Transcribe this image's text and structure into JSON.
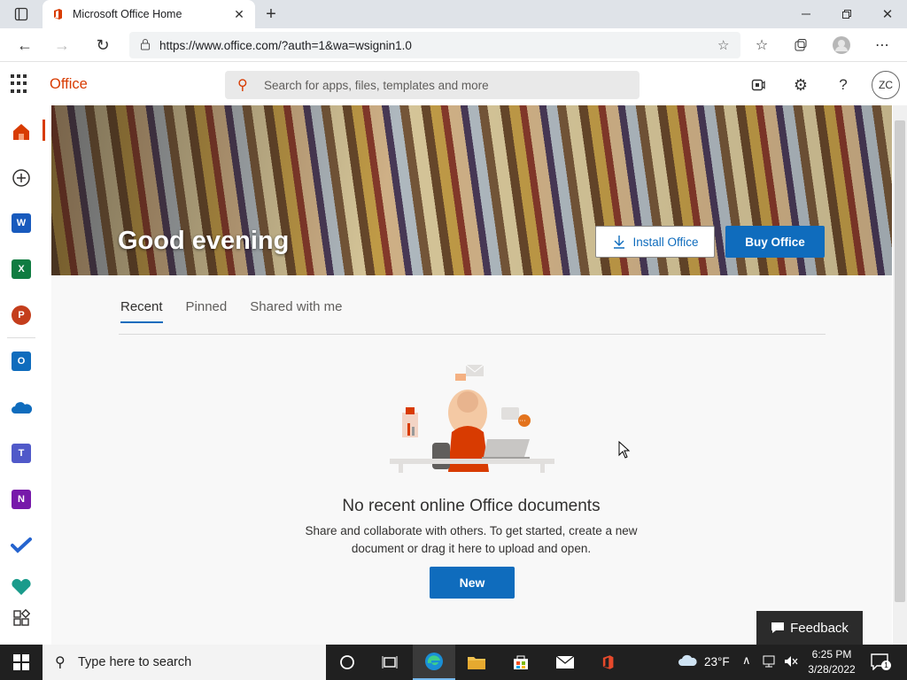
{
  "browser": {
    "tab_title": "Microsoft Office Home",
    "url": "https://www.office.com/?auth=1&wa=wsignin1.0"
  },
  "header": {
    "brand": "Office",
    "search_placeholder": "Search for apps, files, templates and more",
    "avatar_initials": "ZC"
  },
  "hero": {
    "greeting": "Good evening",
    "install_label": "Install Office",
    "buy_label": "Buy Office"
  },
  "tabs": [
    {
      "label": "Recent",
      "active": true
    },
    {
      "label": "Pinned",
      "active": false
    },
    {
      "label": "Shared with me",
      "active": false
    }
  ],
  "empty_state": {
    "title": "No recent online Office documents",
    "description": "Share and collaborate with others. To get started, create a new document or drag it here to upload and open.",
    "new_label": "New"
  },
  "feedback_label": "Feedback",
  "rail": {
    "apps": [
      {
        "icon": "home-icon",
        "color": "#d83b01"
      },
      {
        "icon": "create-icon",
        "color": "#323130"
      },
      {
        "icon": "word-icon",
        "color": "#185abd",
        "letter": "W"
      },
      {
        "icon": "excel-icon",
        "color": "#107c41",
        "letter": "X"
      },
      {
        "icon": "powerpoint-icon",
        "color": "#c43e1c",
        "letter": "P"
      },
      {
        "icon": "outlook-icon",
        "color": "#0f6cbd",
        "letter": "O"
      },
      {
        "icon": "onedrive-icon",
        "color": "#0f6cbd"
      },
      {
        "icon": "teams-icon",
        "color": "#5059c9",
        "letter": "T"
      },
      {
        "icon": "onenote-icon",
        "color": "#7719aa",
        "letter": "N"
      },
      {
        "icon": "todo-icon",
        "color": "#2564cf"
      },
      {
        "icon": "family-safety-icon",
        "color": "#1a9b8b"
      },
      {
        "icon": "all-apps-icon",
        "color": "#323130"
      }
    ]
  },
  "taskbar": {
    "search_placeholder": "Type here to search",
    "temperature": "23°F",
    "time": "6:25 PM",
    "date": "3/28/2022",
    "notification_count": "1"
  },
  "colors": {
    "accent": "#d83b01",
    "primary": "#0f6cbd"
  }
}
